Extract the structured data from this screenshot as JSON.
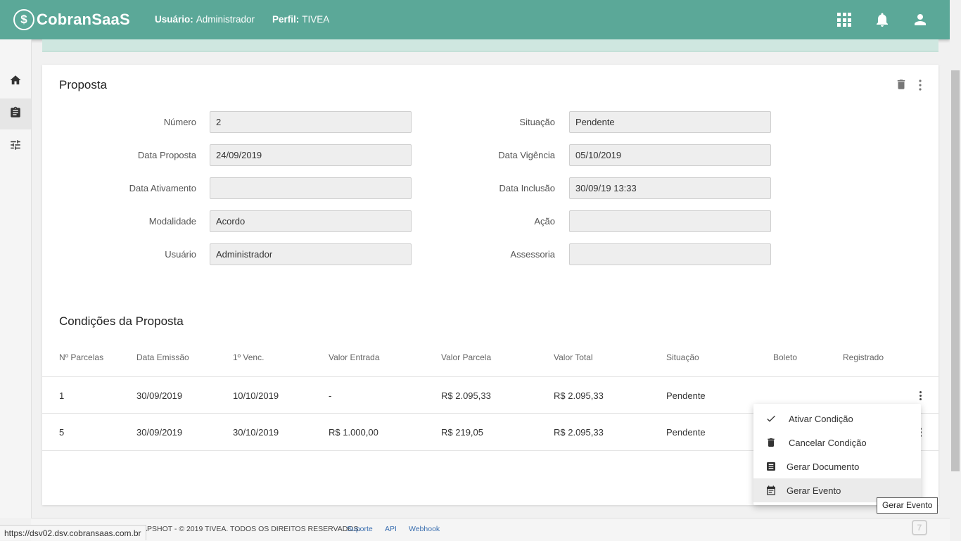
{
  "header": {
    "logo_mark": "$",
    "logo_text": "CobranSaaS",
    "user_label": "Usuário:",
    "user_value": "Administrador",
    "profile_label": "Perfil:",
    "profile_value": "TIVEA",
    "icons": [
      "apps-icon",
      "bell-icon",
      "account-icon"
    ]
  },
  "sidebar": {
    "items": [
      {
        "icon": "home-icon"
      },
      {
        "icon": "clipboard-icon",
        "active": true
      },
      {
        "icon": "tune-icon"
      }
    ]
  },
  "proposal": {
    "title": "Proposta",
    "fields": {
      "numero": {
        "label": "Número",
        "value": "2"
      },
      "situacao": {
        "label": "Situação",
        "value": "Pendente"
      },
      "data_proposta": {
        "label": "Data Proposta",
        "value": "24/09/2019"
      },
      "data_vigencia": {
        "label": "Data Vigência",
        "value": "05/10/2019"
      },
      "data_ativamento": {
        "label": "Data Ativamento",
        "value": ""
      },
      "data_inclusao": {
        "label": "Data Inclusão",
        "value": "30/09/19 13:33"
      },
      "modalidade": {
        "label": "Modalidade",
        "value": "Acordo"
      },
      "acao": {
        "label": "Ação",
        "value": ""
      },
      "usuario": {
        "label": "Usuário",
        "value": "Administrador"
      },
      "assessoria": {
        "label": "Assessoria",
        "value": ""
      }
    }
  },
  "conditions": {
    "title": "Condições da Proposta",
    "columns": [
      "Nº Parcelas",
      "Data Emissão",
      "1º Venc.",
      "Valor Entrada",
      "Valor Parcela",
      "Valor Total",
      "Situação",
      "Boleto",
      "Registrado"
    ],
    "rows": [
      {
        "parcelas": "1",
        "emissao": "30/09/2019",
        "venc": "10/10/2019",
        "entrada": "-",
        "parcela": "R$ 2.095,33",
        "total": "R$ 2.095,33",
        "situacao": "Pendente"
      },
      {
        "parcelas": "5",
        "emissao": "30/09/2019",
        "venc": "30/10/2019",
        "entrada": "R$ 1.000,00",
        "parcela": "R$ 219,05",
        "total": "R$ 2.095,33",
        "situacao": "Pendente"
      }
    ]
  },
  "menu": {
    "items": [
      {
        "label": "Ativar Condição",
        "icon": "check-icon"
      },
      {
        "label": "Cancelar Condição",
        "icon": "trash-icon"
      },
      {
        "label": "Gerar Documento",
        "icon": "document-icon"
      },
      {
        "label": "Gerar Evento",
        "icon": "event-icon",
        "hover": true
      }
    ],
    "tooltip": "Gerar Evento"
  },
  "footer": {
    "copyright": "APSHOT - © 2019 TIVEA. TODOS OS DIREITOS RESERVADOS.",
    "links": [
      "Suporte",
      "API",
      "Webhook"
    ],
    "status_url": "https://dsv02.dsv.cobransaas.com.br"
  },
  "colors": {
    "header": "#5ba898",
    "alert": "#cfe7e0"
  }
}
